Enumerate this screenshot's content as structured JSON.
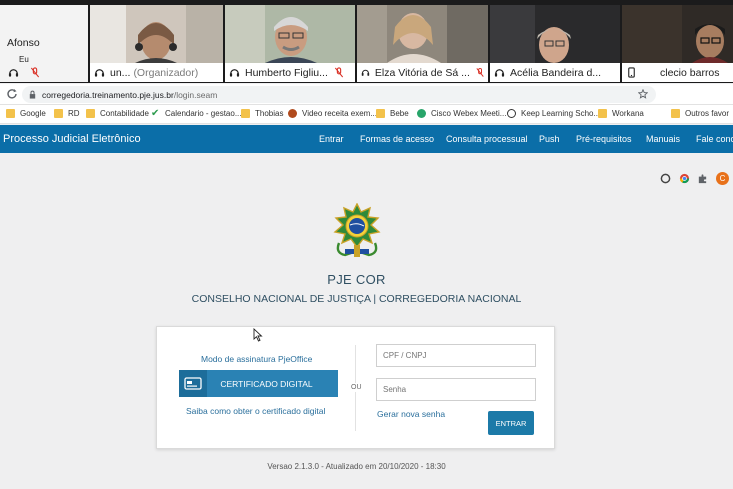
{
  "participants": {
    "self": {
      "name": "Afonso",
      "sub": "Eu"
    },
    "tiles": [
      {
        "name": "un...",
        "role": "(Organizador)"
      },
      {
        "name": "Humberto Figliu..."
      },
      {
        "name": "Elza Vitória de Sá ..."
      },
      {
        "name": "Acélia Bandeira d..."
      },
      {
        "name": "clecio barros"
      }
    ]
  },
  "browser": {
    "url_host": "corregedoria.treinamento.pje.jus.br",
    "url_path": "/login.seam",
    "profile_initial": "C",
    "bookmarks": [
      "Google",
      "RD",
      "Contabilidade",
      "Calendario - gestao...",
      "Thobias",
      "Video receita exem...",
      "Bebe",
      "Cisco Webex Meeti...",
      "Keep Learning Scho...",
      "Workana",
      "Outros favor"
    ]
  },
  "site": {
    "brand": "Processo Judicial Eletrônico",
    "nav": [
      "Entrar",
      "Formas de acesso",
      "Consulta processual",
      "Push",
      "Pré-requisitos",
      "Manuais",
      "Fale conos"
    ],
    "title": "PJE COR",
    "subtitle": "CONSELHO NACIONAL DE JUSTIÇA | CORREGEDORIA NACIONAL",
    "login": {
      "pjeoffice": "Modo de assinatura PjeOffice",
      "cert_button": "CERTIFICADO DIGITAL",
      "saiba": "Saiba como obter o certificado digital",
      "ou": "OU",
      "cpf_placeholder": "CPF / CNPJ",
      "senha_placeholder": "Senha",
      "gerar": "Gerar nova senha",
      "entrar": "ENTRAR"
    },
    "version": "Versao 2.1.3.0 - Atualizado em 20/10/2020 - 18:30"
  }
}
